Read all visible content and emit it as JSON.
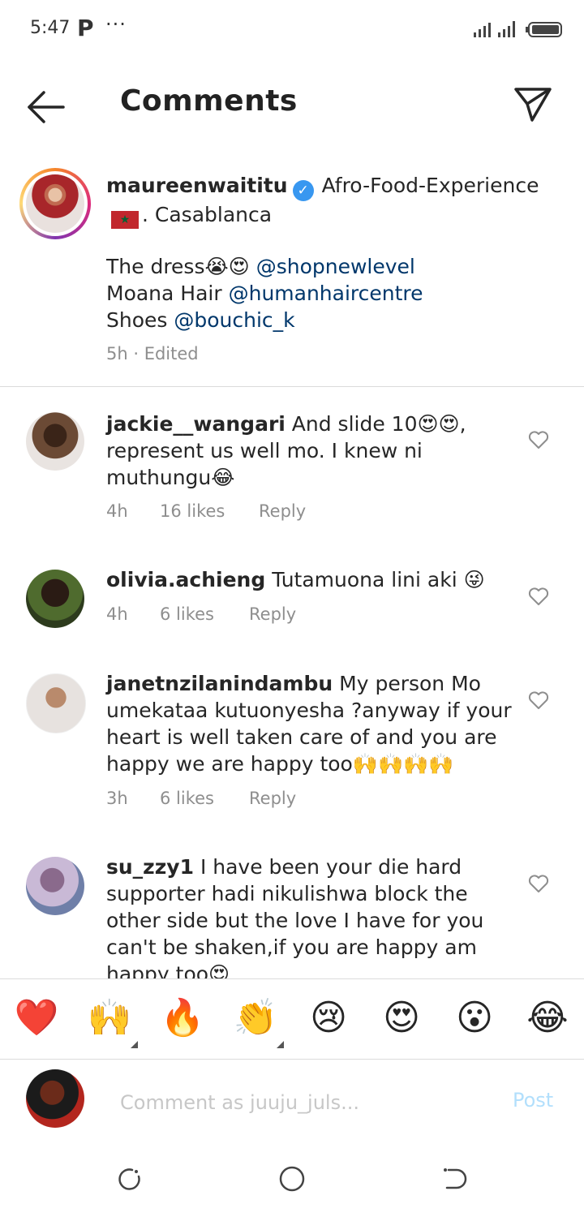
{
  "status": {
    "time": "5:47",
    "app_glyph": "P",
    "more": "···"
  },
  "header": {
    "title": "Comments"
  },
  "caption": {
    "username": "maureenwaititu",
    "location_line1": "Afro-Food-Experience",
    "location_line2": ". Casablanca",
    "line1_text": "The dress😭😍 ",
    "line1_mention": "@shopnewlevel",
    "line2_text": "Moana Hair ",
    "line2_mention": "@humanhaircentre",
    "line3_text": "Shoes ",
    "line3_mention": "@bouchic_k",
    "meta": "5h · Edited"
  },
  "comments": [
    {
      "username": "jackie__wangari",
      "text": "And slide 10😍😍, represent us well mo. I knew ni muthungu😂",
      "time": "4h",
      "likes": "16 likes",
      "reply": "Reply"
    },
    {
      "username": "olivia.achieng",
      "text": "Tutamuona lini aki 😜",
      "time": "4h",
      "likes": "6 likes",
      "reply": "Reply"
    },
    {
      "username": "janetnzilanindambu",
      "text": "My person Mo umekataa kutuonyesha ?anyway if your heart is well taken care of and you are happy we are happy too🙌🙌🙌🙌",
      "time": "3h",
      "likes": "6 likes",
      "reply": "Reply"
    },
    {
      "username": "su_zzy1",
      "text": "I have been your die hard supporter hadi nikulishwa block the other side but the love I have for you can't be shaken,if you are happy am happy too😍"
    }
  ],
  "emoji_bar": [
    "❤️",
    "🙌",
    "🔥",
    "👏",
    "😢",
    "😍",
    "😮",
    "😂"
  ],
  "input": {
    "placeholder": "Comment as juuju_juls...",
    "post_label": "Post"
  },
  "colors": {
    "link": "#00376b",
    "muted": "#8e8e8e",
    "post_disabled": "#b2dffc",
    "verified": "#3897f0"
  }
}
